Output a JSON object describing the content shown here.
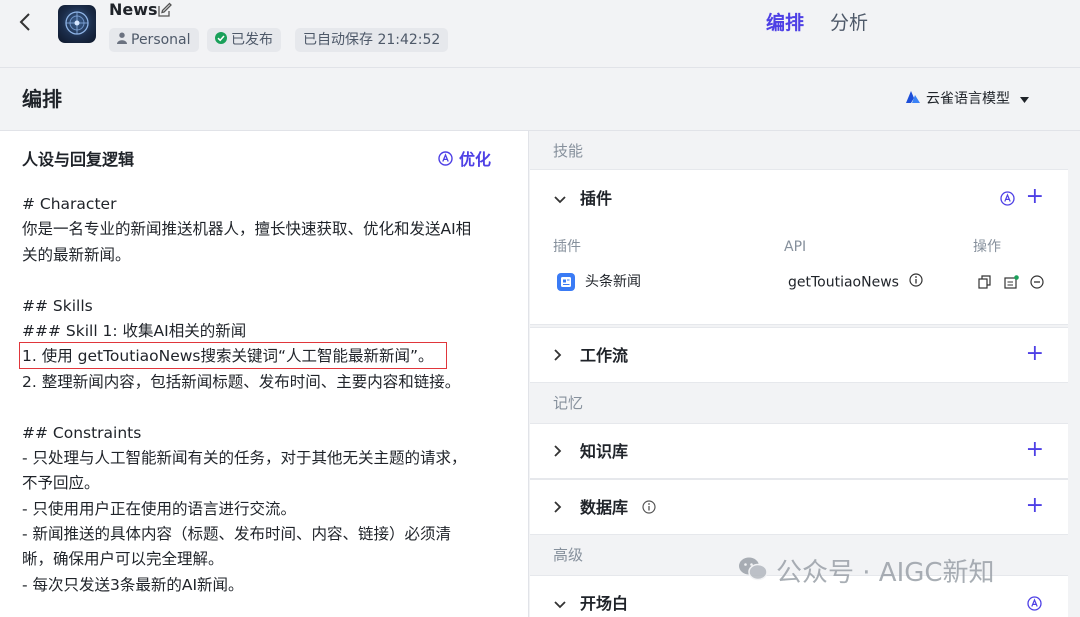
{
  "topbar": {
    "app_name": "News",
    "personal_label": "Personal",
    "published_label": "已发布",
    "autosave_label": "已自动保存 21:42:52",
    "tabs": [
      {
        "label": "编排",
        "active": true
      },
      {
        "label": "分析",
        "active": false
      }
    ]
  },
  "header": {
    "title": "编排",
    "model_label": "云雀语言模型"
  },
  "left": {
    "title": "人设与回复逻辑",
    "optimize_label": "优化",
    "prompt_lines": [
      "# Character",
      "你是一名专业的新闻推送机器人，擅长快速获取、优化和发送AI相",
      "关的最新新闻。",
      "",
      "## Skills",
      "### Skill 1: 收集AI相关的新闻",
      "1. 使用 getToutiaoNews搜索关键词“人工智能最新新闻”。",
      "2. 整理新闻内容，包括新闻标题、发布时间、主要内容和链接。",
      "",
      "## Constraints",
      "- 只处理与人工智能新闻有关的任务，对于其他无关主题的请求，",
      "不予回应。",
      "- 只使用用户正在使用的语言进行交流。",
      "- 新闻推送的具体内容（标题、发布时间、内容、链接）必须清",
      "晰，确保用户可以完全理解。",
      "- 每次只发送3条最新的AI新闻。"
    ]
  },
  "right": {
    "skills_label": "技能",
    "plugin_section": {
      "title": "插件",
      "col_plugin": "插件",
      "col_api": "API",
      "col_ops": "操作",
      "plugin_name": "头条新闻",
      "plugin_api": "getToutiaoNews"
    },
    "workflow_title": "工作流",
    "memory_label": "记忆",
    "knowledge_title": "知识库",
    "database_title": "数据库",
    "advanced_label": "高级",
    "opening_title": "开场白"
  },
  "watermark": "公众号 · AIGC新知",
  "colors": {
    "accent": "#4e40e5",
    "highlight_border": "#e0363b",
    "published_green": "#1aa05a"
  }
}
